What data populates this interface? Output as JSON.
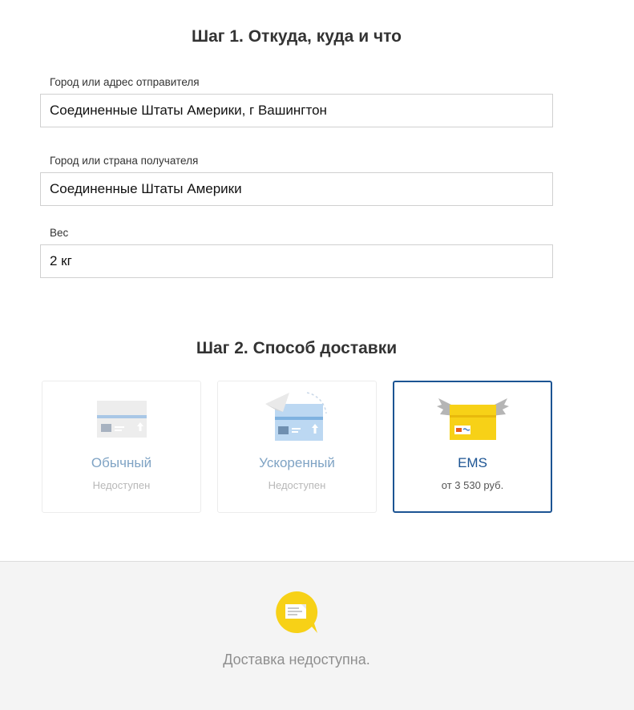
{
  "step1": {
    "title": "Шаг 1. Откуда, куда и что",
    "sender": {
      "label": "Город или адрес отправителя",
      "value": "Соединенные Штаты Америки, г Вашингтон"
    },
    "recipient": {
      "label": "Город или страна получателя",
      "value": "Соединенные Штаты Америки"
    },
    "weight": {
      "label": "Вес",
      "value": "2 кг"
    }
  },
  "step2": {
    "title": "Шаг 2. Способ доставки",
    "options": [
      {
        "name": "Обычный",
        "status": "Недоступен",
        "icon": "regular-parcel-icon",
        "selected": false
      },
      {
        "name": "Ускоренный",
        "status": "Недоступен",
        "icon": "express-parcel-icon",
        "selected": false
      },
      {
        "name": "EMS",
        "status": "от 3 530 руб.",
        "icon": "ems-box-icon",
        "selected": true
      }
    ]
  },
  "footer": {
    "icon": "message-bubble-icon",
    "text": "Доставка недоступна."
  },
  "colors": {
    "accent": "#1c5493",
    "ems_yellow": "#f7d117",
    "muted_blue": "#7fa3c4",
    "footer_bg": "#f4f4f4"
  }
}
